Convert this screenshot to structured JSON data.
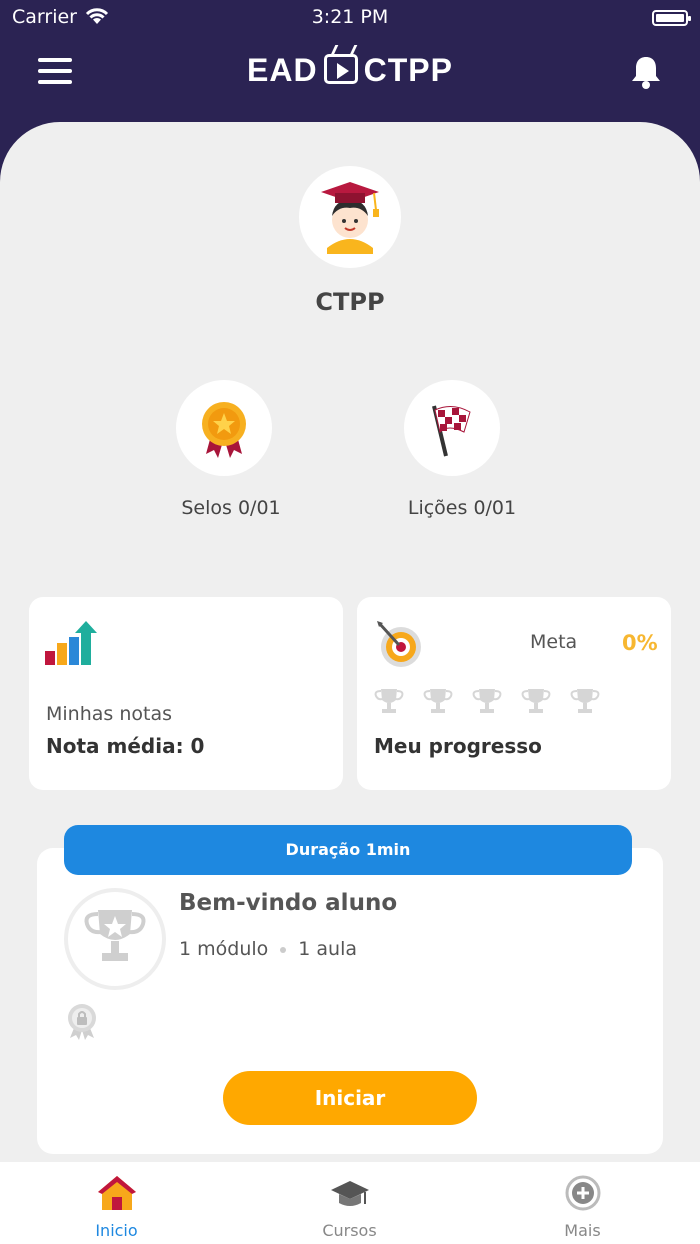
{
  "status_bar": {
    "carrier": "Carrier",
    "time": "3:21 PM"
  },
  "header": {
    "logo_left": "EAD",
    "logo_right": "CTPP"
  },
  "profile": {
    "name": "CTPP"
  },
  "stats": {
    "selos": {
      "label": "Selos 0/01",
      "icon": "medal-icon"
    },
    "licoes": {
      "label": "Lições 0/01",
      "icon": "checkered-flag-icon"
    }
  },
  "notes_card": {
    "label": "Minhas notas",
    "value": "Nota média: 0",
    "icon": "bar-chart-icon"
  },
  "progress_card": {
    "meta_label": "Meta",
    "meta_value": "0%",
    "title": "Meu progresso",
    "trophies": 5,
    "icon": "target-icon"
  },
  "course": {
    "duration": "Duração 1min",
    "title": "Bem-vindo aluno",
    "modules": "1 módulo",
    "lessons": "1 aula",
    "start_label": "Iniciar"
  },
  "tabs": [
    {
      "label": "Inicio",
      "icon": "home-icon",
      "active": true
    },
    {
      "label": "Cursos",
      "icon": "graduation-cap-icon",
      "active": false
    },
    {
      "label": "Mais",
      "icon": "plus-circle-icon",
      "active": false
    }
  ],
  "colors": {
    "header": "#2b2353",
    "accent_blue": "#1e88e0",
    "accent_orange": "#ffa800",
    "meta_percent": "#f7b731"
  }
}
